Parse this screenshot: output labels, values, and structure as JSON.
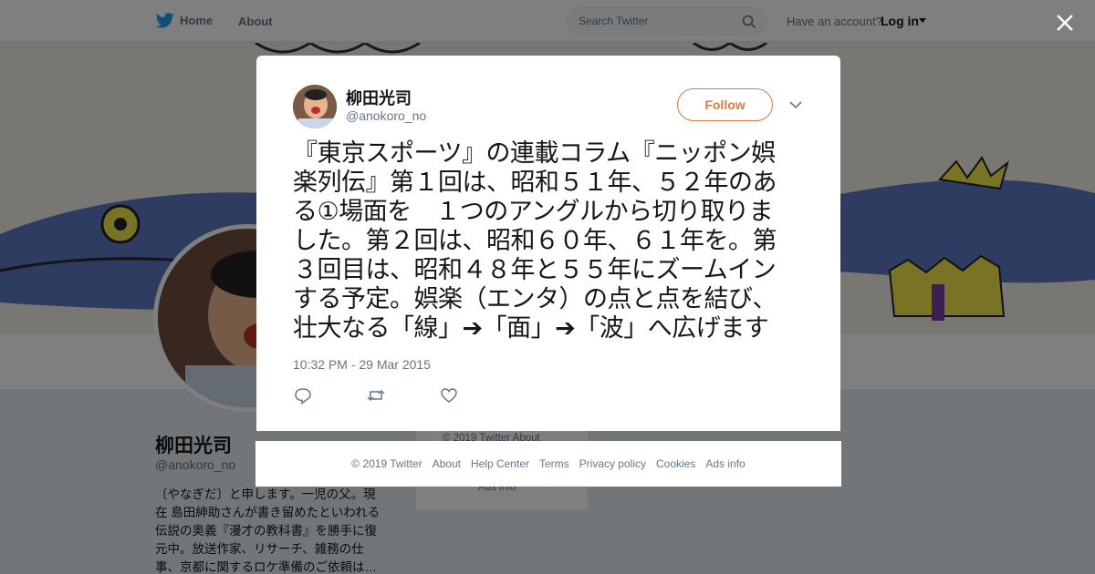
{
  "topbar": {
    "home_label": "Home",
    "about_label": "About",
    "search_placeholder": "Search Twitter",
    "have_account": "Have an account?",
    "login_label": "Log in"
  },
  "background_profile": {
    "name": "柳田光司",
    "handle": "@anokoro_no",
    "bio_lines": [
      "〔やなぎだ〕と申します。一児の父。現",
      "在 島田紳助さんが書き留めたといわれる",
      "伝説の奥義『漫才の教科書』を勝手に復",
      "元中。放送作家、リサーチ、雑務の仕",
      "事、京都に関するロケ準備のご依頼は…"
    ],
    "side_footer_1": "© 2019 Twitter   About",
    "side_footer_2": "Ads info"
  },
  "tweet": {
    "author_name": "柳田光司",
    "author_handle": "@anokoro_no",
    "follow_label": "Follow",
    "text_lines": [
      "『東京スポーツ』の連載コラム『ニッポン娯",
      "楽列伝』第１回は、昭和５１年、５２年のあ",
      "る①場面を　１つのアングルから切り取りま",
      "した。第２回は、昭和６０年、６１年を。第",
      "３回目は、昭和４８年と５５年にズームイン",
      "する予定。娯楽（エンタ）の点と点を結び、",
      "壮大なる「線」➔「面」➔「波」へ広げます"
    ],
    "timestamp": "10:32 PM - 29 Mar 2015"
  },
  "footer": {
    "links": [
      "© 2019 Twitter",
      "About",
      "Help Center",
      "Terms",
      "Privacy policy",
      "Cookies",
      "Ads info"
    ]
  },
  "colors": {
    "accent": "#e0793e",
    "twitter_blue": "#1da1f2",
    "overlay": "rgba(0,0,0,0.5)"
  },
  "icons": [
    "twitter-bird-icon",
    "search-icon",
    "close-icon",
    "chevron-down-icon",
    "reply-icon",
    "retweet-icon",
    "like-icon"
  ]
}
